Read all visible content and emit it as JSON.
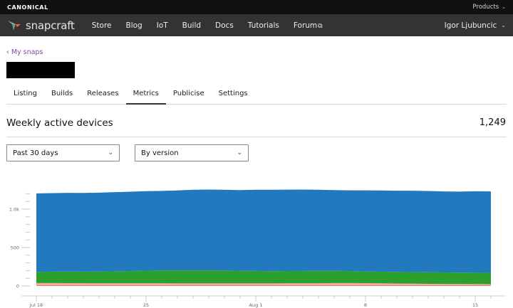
{
  "canonical_bar": {
    "logo_text": "CANONICAL",
    "products_label": "Products"
  },
  "nav": {
    "brand": "snapcraft",
    "links": [
      {
        "label": "Store"
      },
      {
        "label": "Blog"
      },
      {
        "label": "IoT"
      },
      {
        "label": "Build"
      },
      {
        "label": "Docs"
      },
      {
        "label": "Tutorials"
      },
      {
        "label": "Forum"
      }
    ],
    "user_name": "Igor Ljubuncic"
  },
  "breadcrumb": "‹ My snaps",
  "tabs": [
    {
      "label": "Listing"
    },
    {
      "label": "Builds"
    },
    {
      "label": "Releases"
    },
    {
      "label": "Metrics",
      "active": true
    },
    {
      "label": "Publicise"
    },
    {
      "label": "Settings"
    }
  ],
  "metrics": {
    "heading": "Weekly active devices",
    "total": "1,249",
    "period_select": "Past 30 days",
    "type_select": "By version"
  },
  "colors": {
    "nav_bg": "#333333",
    "canonical_bg": "#111111",
    "breadcrumb": "#7b4d9e",
    "series_blue": "#2279be",
    "series_green": "#2ca02c",
    "series_salmon": "#f4a598",
    "series_pink": "#e57f8a"
  },
  "chart_data": {
    "type": "area",
    "x": [
      "Jul 18",
      "Jul 19",
      "Jul 20",
      "Jul 21",
      "Jul 22",
      "Jul 23",
      "Jul 24",
      "Jul 25",
      "Jul 26",
      "Jul 27",
      "Jul 28",
      "Jul 29",
      "Jul 30",
      "Jul 31",
      "Aug 1",
      "Aug 2",
      "Aug 3",
      "Aug 4",
      "Aug 5",
      "Aug 6",
      "Aug 7",
      "Aug 8",
      "Aug 9",
      "Aug 10",
      "Aug 11",
      "Aug 12",
      "Aug 13",
      "Aug 14",
      "Aug 15",
      "Aug 16"
    ],
    "x_tick_labels": [
      {
        "x": "Jul 18",
        "label": "Jul 18"
      },
      {
        "x": "Jul 25",
        "label": "25"
      },
      {
        "x": "Aug 1",
        "label": "Aug 1"
      },
      {
        "x": "Aug 8",
        "label": "8"
      },
      {
        "x": "Aug 15",
        "label": "15"
      }
    ],
    "y_ticks": [
      {
        "value": 0,
        "label": "0"
      },
      {
        "value": 500,
        "label": "500"
      },
      {
        "value": 1000,
        "label": "1.0k"
      }
    ],
    "ylim": [
      0,
      1300
    ],
    "stacked": true,
    "series": [
      {
        "color": "#e57f8a",
        "values": [
          10,
          10,
          10,
          10,
          10,
          10,
          10,
          10,
          10,
          10,
          10,
          10,
          10,
          10,
          10,
          10,
          10,
          10,
          10,
          10,
          10,
          10,
          10,
          10,
          10,
          10,
          10,
          10,
          10,
          10
        ]
      },
      {
        "color": "#f4a598",
        "values": [
          28,
          28,
          27,
          26,
          25,
          25,
          24,
          24,
          24,
          23,
          23,
          23,
          23,
          23,
          23,
          23,
          24,
          25,
          26,
          28,
          28,
          27,
          25,
          22,
          20,
          18,
          16,
          15,
          14,
          13
        ]
      },
      {
        "color": "#2ca02c",
        "values": [
          145,
          148,
          150,
          150,
          152,
          156,
          160,
          165,
          168,
          170,
          170,
          170,
          168,
          165,
          162,
          160,
          160,
          160,
          160,
          158,
          156,
          152,
          150,
          150,
          150,
          150,
          150,
          148,
          148,
          148
        ]
      },
      {
        "color": "#2279be",
        "values": [
          1022,
          1022,
          1025,
          1025,
          1027,
          1030,
          1033,
          1035,
          1035,
          1040,
          1050,
          1052,
          1052,
          1050,
          1057,
          1060,
          1060,
          1060,
          1057,
          1052,
          1050,
          1055,
          1058,
          1058,
          1060,
          1058,
          1055,
          1055,
          1060,
          1060
        ]
      }
    ]
  }
}
